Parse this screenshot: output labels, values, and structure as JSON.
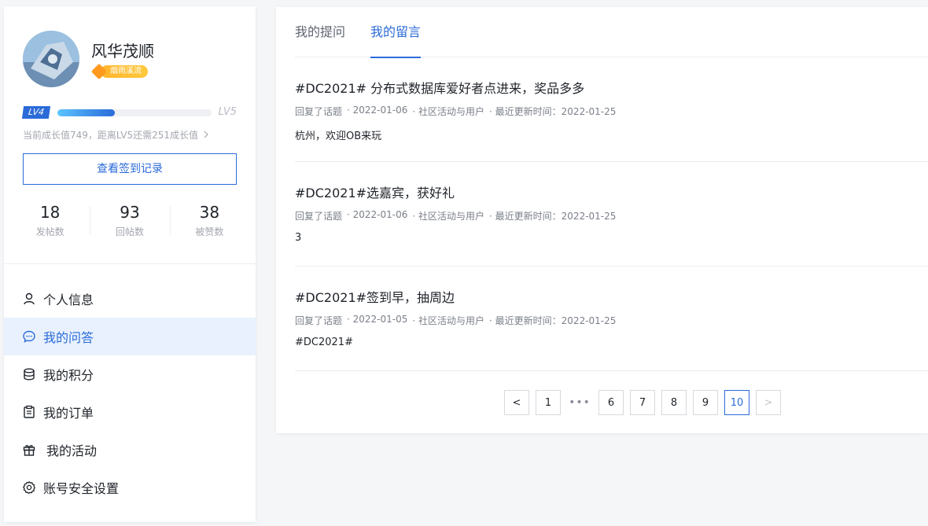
{
  "profile": {
    "username": "风华茂顺",
    "badge_label": "烟雨溪流",
    "level_current": "LV4",
    "level_next": "LV5",
    "level_progress": 0.37,
    "growth_hint": "当前成长值749，距离LV5还需251成长值",
    "signin_record_label": "查看签到记录",
    "stats": [
      {
        "value": "18",
        "label": "发帖数"
      },
      {
        "value": "93",
        "label": "回帖数"
      },
      {
        "value": "38",
        "label": "被赞数"
      }
    ]
  },
  "menu": [
    {
      "label": "个人信息",
      "icon": "user-icon"
    },
    {
      "label": "我的问答",
      "icon": "chat-icon",
      "active": true
    },
    {
      "label": "我的积分",
      "icon": "database-icon"
    },
    {
      "label": "我的订单",
      "icon": "clipboard-icon"
    },
    {
      "label": "我的活动",
      "icon": "gift-icon"
    },
    {
      "label": "账号安全设置",
      "icon": "gear-icon"
    }
  ],
  "tabs": [
    {
      "label": "我的提问"
    },
    {
      "label": "我的留言",
      "active": true
    }
  ],
  "items": [
    {
      "title": "#DC2021# 分布式数据库爱好者点进来，奖品多多",
      "reply_label": "回复了话题",
      "date": "· 2022-01-06",
      "category": "· 社区活动与用户",
      "updated": "· 最近更新时间：2022-01-25",
      "body": "杭州，欢迎OB来玩"
    },
    {
      "title": "#DC2021#选嘉宾，获好礼",
      "reply_label": "回复了话题",
      "date": "· 2022-01-06",
      "category": "· 社区活动与用户",
      "updated": "· 最近更新时间：2022-01-25",
      "body": "3"
    },
    {
      "title": "#DC2021#签到早，抽周边",
      "reply_label": "回复了话题",
      "date": "· 2022-01-05",
      "category": "· 社区活动与用户",
      "updated": "· 最近更新时间：2022-01-25",
      "body": "#DC2021#"
    }
  ],
  "pagination": {
    "prev": "<",
    "first": "1",
    "ellipsis": "•••",
    "pages": [
      "6",
      "7",
      "8",
      "9",
      "10"
    ],
    "current": "10",
    "next": ">"
  },
  "colors": {
    "accent": "#2b6bd9",
    "badge": "#ffb42b"
  }
}
